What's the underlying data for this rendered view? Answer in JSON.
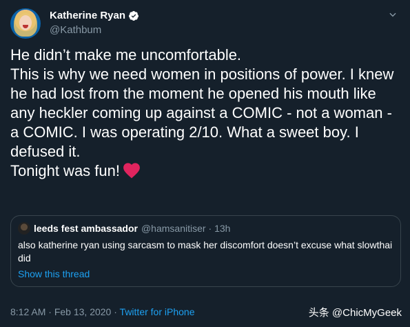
{
  "author": {
    "name": "Katherine Ryan",
    "handle": "@Kathbum",
    "verified_icon": "verified-badge-icon"
  },
  "tweet": {
    "text": "He didn’t make me uncomfortable.\nThis is why we need women in positions of power. I knew he had lost from the moment he opened his mouth like any heckler coming up against a COMIC - not a woman - a COMIC. I was operating 2/10. What a sweet boy. I defused it.\nTonight was fun!",
    "emoji": "red-heart-icon"
  },
  "quoted": {
    "name": "leeds fest ambassador",
    "handle": "@hamsanitiser",
    "age": "· 13h",
    "text": "also katherine ryan using sarcasm to mask her discomfort doesn’t excuse what slowthai did",
    "link": "Show this thread"
  },
  "meta": {
    "time": "8:12 AM",
    "sep1": " · ",
    "date": "Feb 13, 2020",
    "sep2": " · ",
    "source": "Twitter for iPhone"
  },
  "watermark": "头条 @ChicMyGeek",
  "colors": {
    "background": "#15202b",
    "secondary_text": "#8899a6",
    "link": "#1da1f2",
    "heart": "#e0245e"
  }
}
